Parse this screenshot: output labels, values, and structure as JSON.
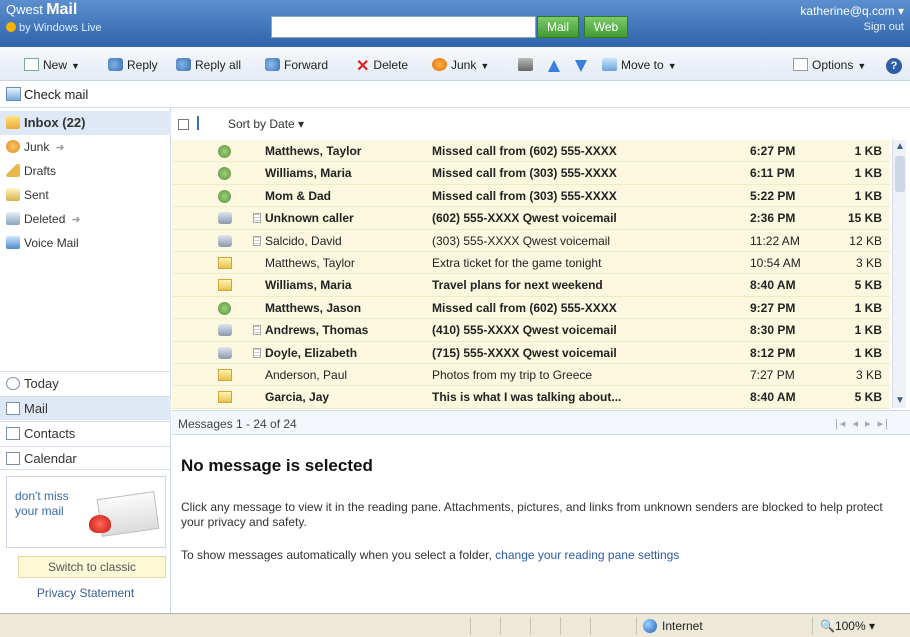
{
  "header": {
    "brand": "Qwest",
    "product": "Mail",
    "powered_by": "by Windows Live",
    "search_mail_label": "Mail",
    "search_web_label": "Web",
    "account_email": "katherine@q.com",
    "sign_out": "Sign out"
  },
  "toolbar": {
    "new": "New",
    "reply": "Reply",
    "reply_all": "Reply all",
    "forward": "Forward",
    "delete": "Delete",
    "junk": "Junk",
    "move_to": "Move to",
    "options": "Options"
  },
  "check_mail": "Check mail",
  "folders": [
    {
      "label": "Inbox (22)",
      "icon": "inbox-icon"
    },
    {
      "label": "Junk",
      "icon": "junk-icon"
    },
    {
      "label": "Drafts",
      "icon": "drafts-icon"
    },
    {
      "label": "Sent",
      "icon": "sent-icon"
    },
    {
      "label": "Deleted",
      "icon": "deleted-icon"
    },
    {
      "label": "Voice Mail",
      "icon": "voicemail-icon"
    }
  ],
  "nav": {
    "today": "Today",
    "mail": "Mail",
    "contacts": "Contacts",
    "calendar": "Calendar"
  },
  "ad": {
    "text": "don't miss your mail"
  },
  "switch_classic": "Switch to classic",
  "privacy": "Privacy Statement",
  "list": {
    "sort_label": "Sort by Date",
    "footer": "Messages 1 - 24 of 24",
    "rows": [
      {
        "type": "missed",
        "attach": false,
        "unread": true,
        "from": "Matthews, Taylor",
        "subject": "Missed call from (602) 555-XXXX",
        "time": "6:27 PM",
        "size": "1 KB"
      },
      {
        "type": "missed",
        "attach": false,
        "unread": true,
        "from": "Williams, Maria",
        "subject": "Missed call from (303) 555-XXXX",
        "time": "6:11 PM",
        "size": "1 KB"
      },
      {
        "type": "missed",
        "attach": false,
        "unread": true,
        "from": "Mom & Dad",
        "subject": "Missed call from (303) 555-XXXX",
        "time": "5:22 PM",
        "size": "1 KB"
      },
      {
        "type": "voicemail",
        "attach": true,
        "unread": true,
        "from": "Unknown caller",
        "subject": "(602) 555-XXXX  Qwest voicemail",
        "time": "2:36 PM",
        "size": "15 KB"
      },
      {
        "type": "voicemail",
        "attach": true,
        "unread": false,
        "from": "Salcido, David",
        "subject": "(303) 555-XXXX  Qwest voicemail",
        "time": "11:22 AM",
        "size": "12 KB"
      },
      {
        "type": "email",
        "attach": false,
        "unread": false,
        "from": "Matthews, Taylor",
        "subject": "Extra ticket for the game tonight",
        "time": "10:54 AM",
        "size": "3 KB"
      },
      {
        "type": "email",
        "attach": false,
        "unread": true,
        "from": "Williams, Maria",
        "subject": "Travel plans for next weekend",
        "time": "8:40 AM",
        "size": "5 KB"
      },
      {
        "type": "missed",
        "attach": false,
        "unread": true,
        "from": "Matthews, Jason",
        "subject": "Missed call from (602) 555-XXXX",
        "time": "9:27 PM",
        "size": "1 KB"
      },
      {
        "type": "voicemail",
        "attach": true,
        "unread": true,
        "from": "Andrews, Thomas",
        "subject": "(410) 555-XXXX  Qwest voicemail",
        "time": "8:30 PM",
        "size": "1 KB"
      },
      {
        "type": "voicemail",
        "attach": true,
        "unread": true,
        "from": "Doyle, Elizabeth",
        "subject": "(715) 555-XXXX  Qwest voicemail",
        "time": "8:12 PM",
        "size": "1 KB"
      },
      {
        "type": "email",
        "attach": false,
        "unread": false,
        "from": "Anderson, Paul",
        "subject": "Photos from my trip to Greece",
        "time": "7:27 PM",
        "size": "3 KB"
      },
      {
        "type": "email",
        "attach": false,
        "unread": true,
        "from": "Garcia, Jay",
        "subject": "This is what I was talking about...",
        "time": "8:40 AM",
        "size": "5 KB"
      }
    ]
  },
  "reading_pane": {
    "title": "No message is selected",
    "body": "Click any message to view it in the reading pane. Attachments, pictures, and links from unknown senders are blocked to help protect your privacy and safety.",
    "link_prefix": "To show messages automatically when you select a folder, ",
    "link_text": "change your reading pane settings"
  },
  "statusbar": {
    "zone": "Internet",
    "zoom": "100%"
  }
}
